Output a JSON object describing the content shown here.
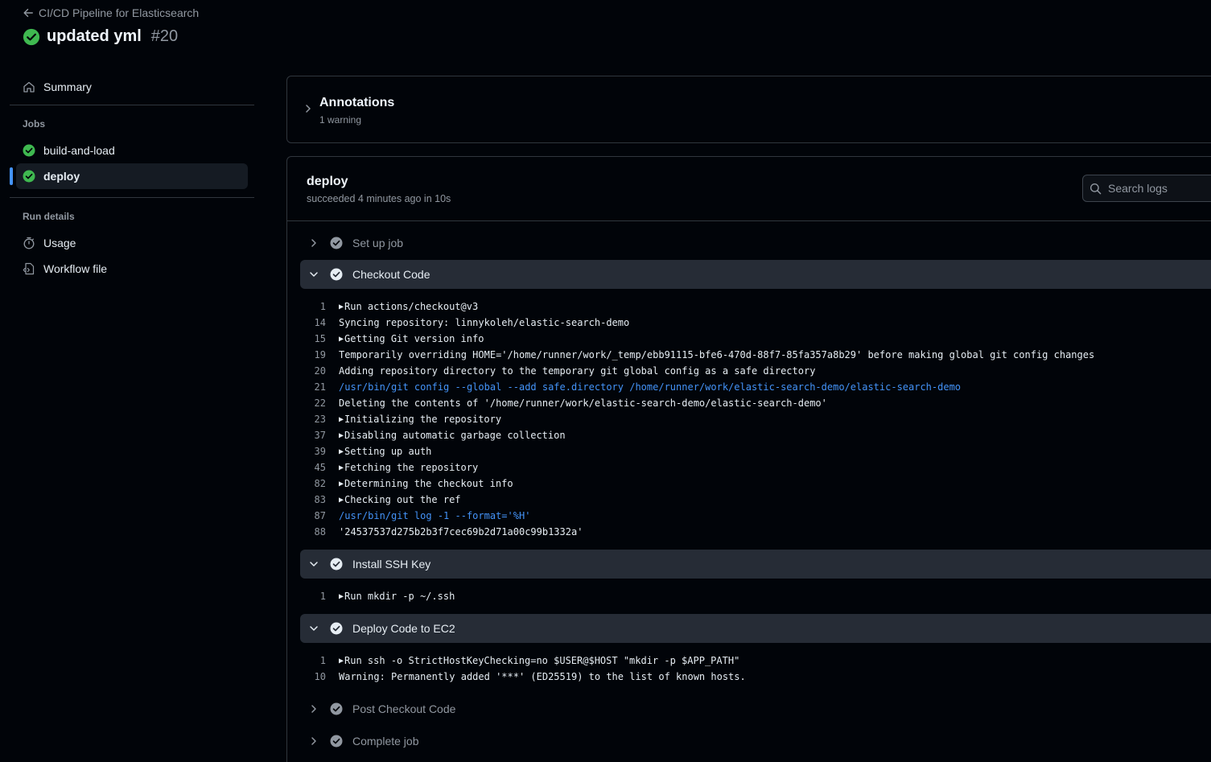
{
  "header": {
    "breadcrumb": "CI/CD Pipeline for Elasticsearch",
    "title": "updated yml",
    "run_number": "#20"
  },
  "sidebar": {
    "summary_label": "Summary",
    "jobs_heading": "Jobs",
    "jobs": [
      {
        "label": "build-and-load"
      },
      {
        "label": "deploy"
      }
    ],
    "run_details_heading": "Run details",
    "usage_label": "Usage",
    "workflow_file_label": "Workflow file"
  },
  "annotations": {
    "title": "Annotations",
    "subtitle": "1 warning"
  },
  "job": {
    "name": "deploy",
    "status": "succeeded 4 minutes ago in 10s",
    "search_placeholder": "Search logs"
  },
  "steps": [
    {
      "label": "Set up job"
    },
    {
      "label": "Checkout Code"
    },
    {
      "label": "Install SSH Key"
    },
    {
      "label": "Deploy Code to EC2"
    },
    {
      "label": "Post Checkout Code"
    },
    {
      "label": "Complete job"
    }
  ],
  "logs": {
    "checkout": [
      {
        "n": "1",
        "t": "Run actions/checkout@v3",
        "group": true
      },
      {
        "n": "14",
        "t": "Syncing repository: linnykoleh/elastic-search-demo"
      },
      {
        "n": "15",
        "t": "Getting Git version info",
        "group": true
      },
      {
        "n": "19",
        "t": "Temporarily overriding HOME='/home/runner/work/_temp/ebb91115-bfe6-470d-88f7-85fa357a8b29' before making global git config changes"
      },
      {
        "n": "20",
        "t": "Adding repository directory to the temporary git global config as a safe directory"
      },
      {
        "n": "21",
        "t": "/usr/bin/git config --global --add safe.directory /home/runner/work/elastic-search-demo/elastic-search-demo",
        "cmd": true
      },
      {
        "n": "22",
        "t": "Deleting the contents of '/home/runner/work/elastic-search-demo/elastic-search-demo'"
      },
      {
        "n": "23",
        "t": "Initializing the repository",
        "group": true
      },
      {
        "n": "37",
        "t": "Disabling automatic garbage collection",
        "group": true
      },
      {
        "n": "39",
        "t": "Setting up auth",
        "group": true
      },
      {
        "n": "45",
        "t": "Fetching the repository",
        "group": true
      },
      {
        "n": "82",
        "t": "Determining the checkout info",
        "group": true
      },
      {
        "n": "83",
        "t": "Checking out the ref",
        "group": true
      },
      {
        "n": "87",
        "t": "/usr/bin/git log -1 --format='%H'",
        "cmd": true
      },
      {
        "n": "88",
        "t": "'24537537d275b2b3f7cec69b2d71a00c99b1332a'"
      }
    ],
    "ssh": [
      {
        "n": "1",
        "t": "Run mkdir -p ~/.ssh",
        "group": true
      }
    ],
    "deploy": [
      {
        "n": "1",
        "t": "Run ssh -o StrictHostKeyChecking=no $USER@$HOST \"mkdir -p $APP_PATH\"",
        "group": true
      },
      {
        "n": "10",
        "t": "Warning: Permanently added '***' (ED25519) to the list of known hosts."
      }
    ]
  },
  "colors": {
    "success": "#3fb950",
    "accent": "#4493f8",
    "background": "#010409"
  }
}
